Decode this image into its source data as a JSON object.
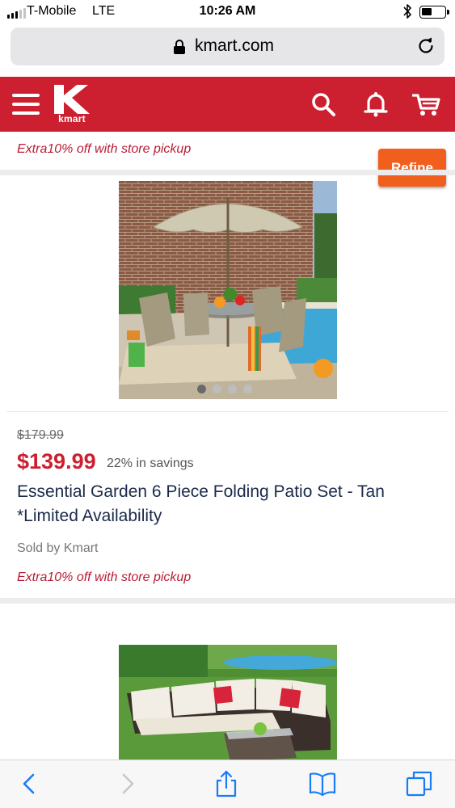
{
  "status_bar": {
    "carrier": "T-Mobile",
    "network": "LTE",
    "time": "10:26 AM"
  },
  "browser": {
    "url": "kmart.com"
  },
  "header": {
    "logo_text": "kmart",
    "brand_color": "#cc1f2f"
  },
  "promo": {
    "store_pickup": "Extra10% off with store pickup"
  },
  "refine_label": "Refine",
  "products": [
    {
      "original_price": "$179.99",
      "price": "$139.99",
      "savings": "22% in savings",
      "title": "Essential Garden 6 Piece Folding Patio Set - Tan *Limited Availability",
      "sold_by": "Sold by Kmart",
      "promo": "Extra10% off with store pickup",
      "image_count": 4,
      "active_image": 1
    },
    {
      "image_count": 1
    }
  ],
  "icons": {
    "header": [
      "menu-icon",
      "search-icon",
      "bell-icon",
      "cart-icon"
    ],
    "toolbar": [
      "back-icon",
      "forward-icon",
      "share-icon",
      "bookmarks-icon",
      "tabs-icon"
    ]
  },
  "colors": {
    "accent_orange": "#f15f1f",
    "price_red": "#cc1f2f",
    "title_navy": "#1b2a4a",
    "ios_blue": "#1a7cf5"
  }
}
